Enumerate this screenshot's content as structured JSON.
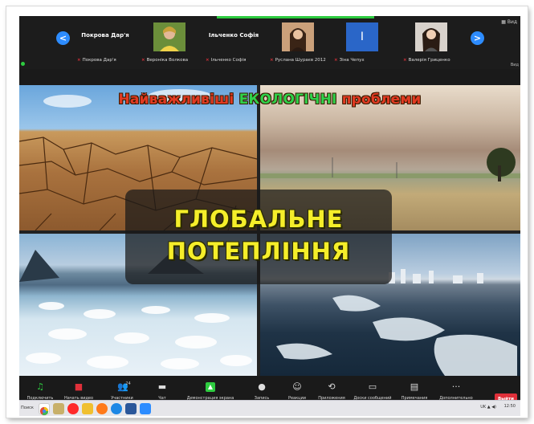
{
  "window": {
    "top_right_label": "Вид",
    "video_label": "Вид"
  },
  "gallery": {
    "prev_label": "<",
    "next_label": ">",
    "tiles": [
      {
        "big_name": "Покрова Дар'я",
        "footer": "Покрова Дар'я"
      },
      {
        "big_name": "",
        "footer": "Вероніка Волкова"
      },
      {
        "big_name": "Ільченко Софія",
        "footer": "Ільченко Софія"
      },
      {
        "big_name": "",
        "footer": "Руслана Шураєв 2012"
      },
      {
        "big_name": "І",
        "footer": "Зіна Чепух"
      },
      {
        "big_name": "",
        "footer": "Валерія Гриценко"
      }
    ]
  },
  "slide": {
    "title_part1": "Найважливіші",
    "title_part2": "ЕКОЛОГІЧНІ",
    "title_part3": "проблеми",
    "headline_line1": "ГЛОБАЛЬНЕ",
    "headline_line2": "ПОТЕПЛІННЯ"
  },
  "toolbar": {
    "items": [
      {
        "label": "Подключить звук",
        "icon": "headphones-icon"
      },
      {
        "label": "Начать видео",
        "icon": "video-off-icon"
      },
      {
        "label": "Участники",
        "icon": "participants-icon",
        "count": "24"
      },
      {
        "label": "Чат",
        "icon": "chat-icon"
      },
      {
        "label": "Демонстрация экрана",
        "icon": "share-screen-icon"
      },
      {
        "label": "Запись",
        "icon": "record-icon"
      },
      {
        "label": "Реакции",
        "icon": "reactions-icon"
      },
      {
        "label": "Приложения",
        "icon": "apps-icon"
      },
      {
        "label": "Доски сообщений",
        "icon": "whiteboard-icon"
      },
      {
        "label": "Примечания",
        "icon": "notes-icon"
      },
      {
        "label": "Дополнительно",
        "icon": "more-icon"
      }
    ],
    "leave_label": "Выйти"
  },
  "taskbar": {
    "start_label": "Поиск",
    "tray_text": "UK",
    "clock": "12:50"
  },
  "colors": {
    "accent": "#2d8cff",
    "share": "#2ecc40",
    "leave": "#e0303a",
    "headline": "#f5ee2a"
  }
}
